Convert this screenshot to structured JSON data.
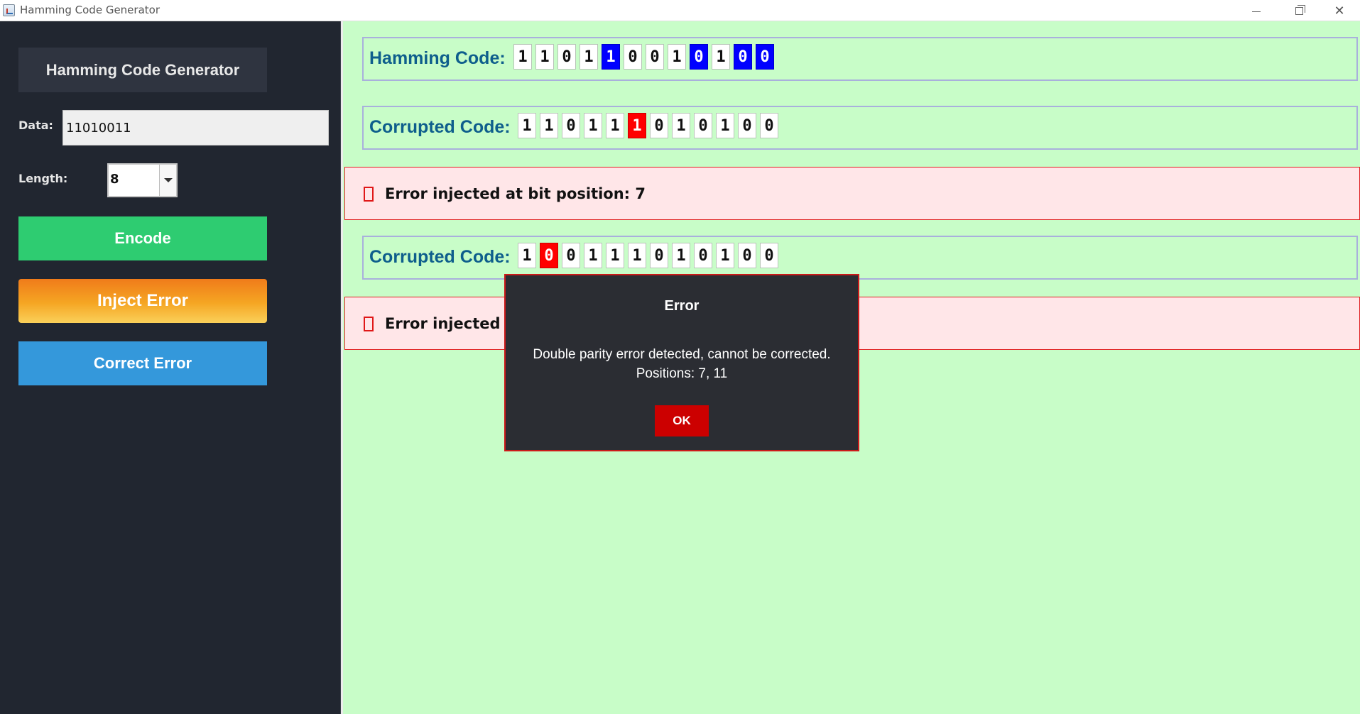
{
  "window": {
    "title": "Hamming Code Generator"
  },
  "sidebar": {
    "title": "Hamming Code Generator",
    "data_label": "Data:",
    "data_value": "11010011",
    "length_label": "Length:",
    "length_value": "8",
    "encode_label": "Encode",
    "inject_label": "Inject Error",
    "correct_label": "Correct Error"
  },
  "main": {
    "hamming": {
      "label": "Hamming Code:",
      "bits": [
        "1",
        "1",
        "0",
        "1",
        "1",
        "0",
        "0",
        "1",
        "0",
        "1",
        "0",
        "0"
      ],
      "parity_positions": [
        5,
        9,
        11,
        12
      ]
    },
    "corrupted_1": {
      "label": "Corrupted Code:",
      "bits": [
        "1",
        "1",
        "0",
        "1",
        "1",
        "1",
        "0",
        "1",
        "0",
        "1",
        "0",
        "0"
      ],
      "flipped_positions": [
        6
      ]
    },
    "message_1": "Error injected at bit position: 7",
    "corrupted_2": {
      "label": "Corrupted Code:",
      "bits": [
        "1",
        "0",
        "0",
        "1",
        "1",
        "1",
        "0",
        "1",
        "0",
        "1",
        "0",
        "0"
      ],
      "flipped_positions": [
        2
      ]
    },
    "message_2": "Error injected at"
  },
  "dialog": {
    "title": "Error",
    "message_line1": "Double parity error detected, cannot be corrected.",
    "message_line2": "Positions: 7, 11",
    "ok_label": "OK"
  },
  "colors": {
    "sidebar_bg": "#212630",
    "main_bg": "#c8fdc8",
    "encode": "#2ecc71",
    "inject": "#f5a623",
    "correct": "#3498db",
    "parity_bit": "#0000ff",
    "flipped_bit": "#ff0000",
    "dialog_border": "#cc1a1a",
    "ok_button": "#cc0000"
  }
}
